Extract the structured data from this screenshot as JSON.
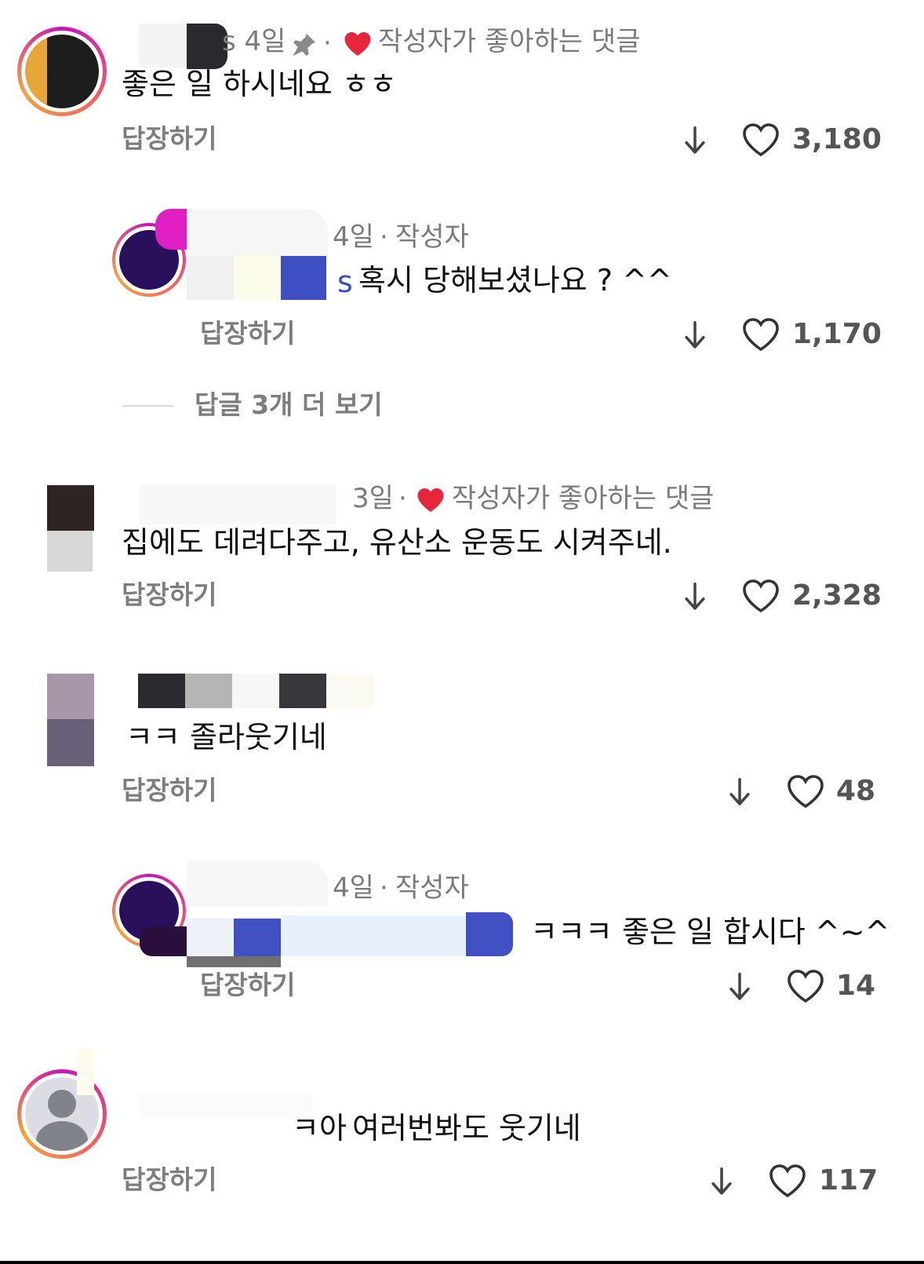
{
  "ui": {
    "reply_label": "답장하기"
  },
  "comments": [
    {
      "meta_prefix": "s",
      "meta_time": "4일",
      "liked_by_author_label": "작성자가 좋아하는 댓글",
      "text": "좋은 일 하시네요 ㅎㅎ",
      "likes": "3,180"
    },
    {
      "meta_time": "4일",
      "author_label": "작성자",
      "mention_suffix": "s",
      "text": "혹시 당해보셨나요 ? ^^",
      "likes": "1,170"
    },
    {
      "meta_time": "3일",
      "liked_by_author_label": "작성자가 좋아하는 댓글",
      "text": "집에도 데려다주고, 유산소 운동도 시켜주네.",
      "likes": "2,328"
    },
    {
      "text": "ㅋㅋ 졸라웃기네",
      "likes": "48"
    },
    {
      "meta_time": "4일",
      "author_label": "작성자",
      "text": "ㅋㅋㅋ 좋은 일 합시다 ^~^",
      "likes": "14"
    },
    {
      "text_prefix": "ㅋ아",
      "text": "여러번봐도 웃기네",
      "likes": "117"
    }
  ],
  "view_more_replies": "답글 3개 더 보기",
  "colors": {
    "heart_red": "#e8263b",
    "ring_start": "#c913b9",
    "ring_end": "#f9a23c",
    "mention": "#3a4fc0"
  },
  "icons": [
    "pin-icon",
    "heart-filled-icon",
    "down-arrow-icon",
    "heart-outline-icon",
    "default-avatar-icon"
  ]
}
